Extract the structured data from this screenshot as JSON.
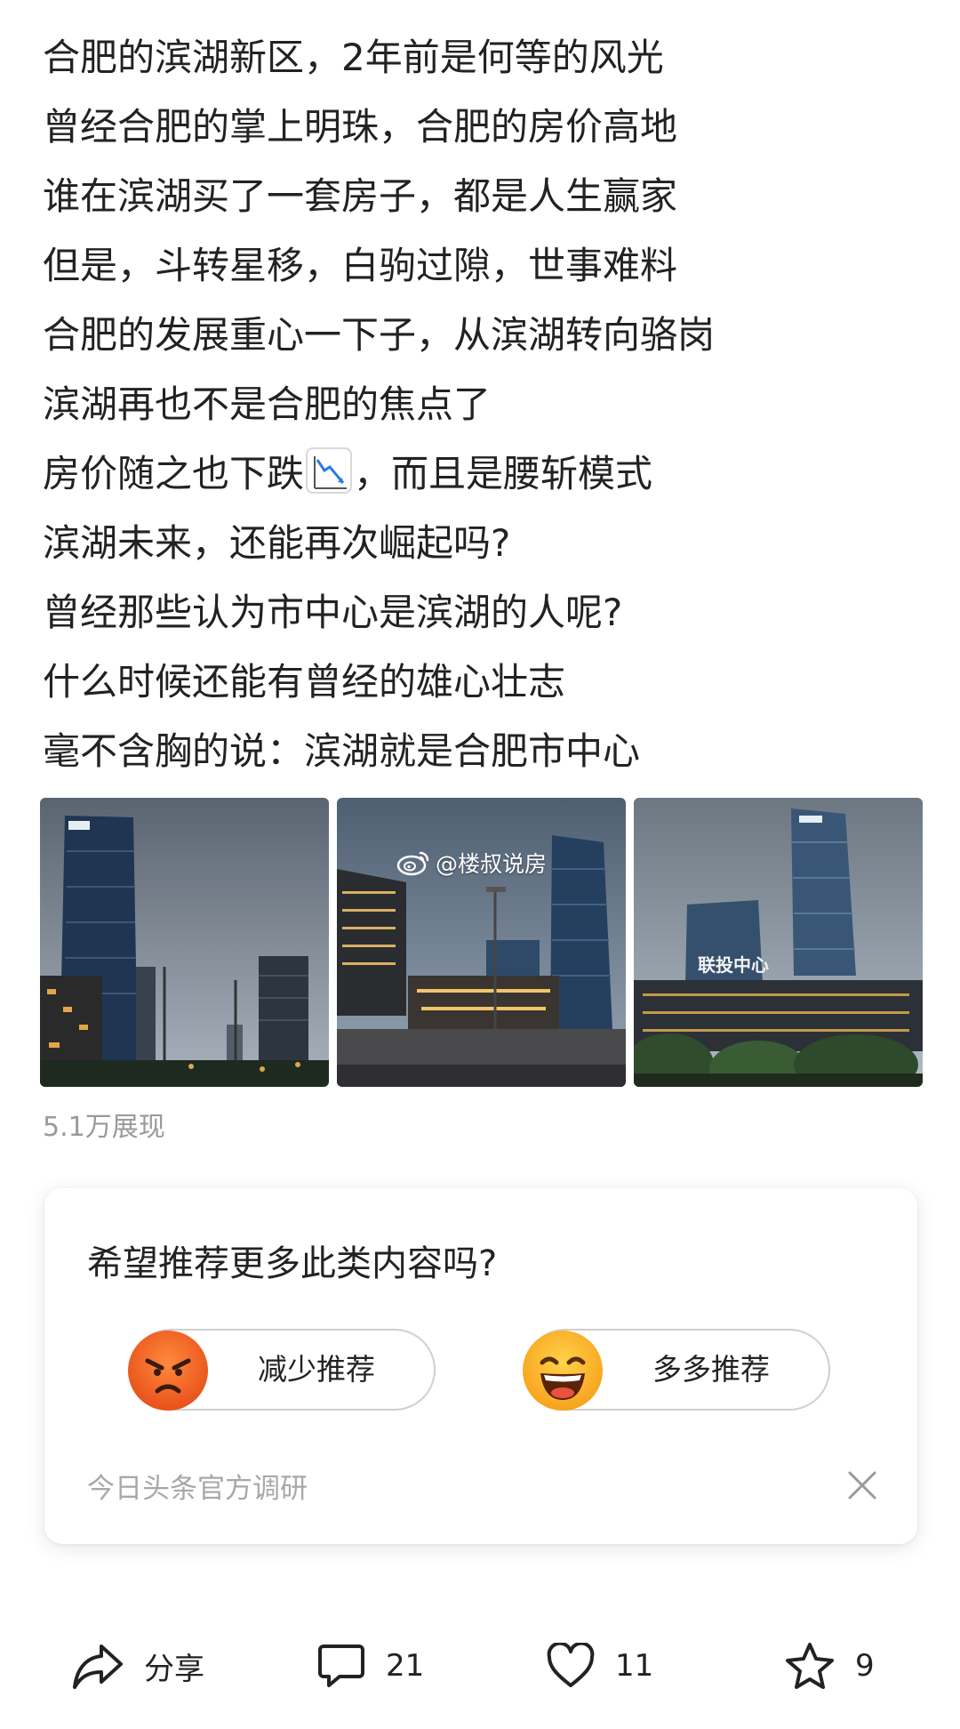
{
  "post": {
    "lines": [
      "合肥的滨湖新区，2年前是何等的风光",
      "曾经合肥的掌上明珠，合肥的房价高地",
      "谁在滨湖买了一套房子，都是人生赢家",
      "但是，斗转星移，白驹过隙，世事难料",
      "合肥的发展重心一下子，从滨湖转向骆岗",
      "滨湖再也不是合肥的焦点了",
      "房价随之也下跌",
      "，而且是腰斩模式",
      "滨湖未来，还能再次崛起吗?",
      "曾经那些认为市中心是滨湖的人呢?",
      "什么时候还能有曾经的雄心壮志",
      "毫不含胸的说：滨湖就是合肥市中心"
    ],
    "emoji": "chart-decreasing-icon",
    "photos": [
      {
        "sign_left": ""
      },
      {
        "sign_mid": ""
      },
      {
        "sign": "联投中心"
      }
    ],
    "watermark": "@楼叔说房",
    "views": "5.1万展现"
  },
  "survey": {
    "question": "希望推荐更多此类内容吗?",
    "less_label": "减少推荐",
    "more_label": "多多推荐",
    "source": "今日头条官方调研",
    "less_color": "#f26a22",
    "more_color": "#ffb21e"
  },
  "actions": {
    "share_label": "分享",
    "comments": "21",
    "likes": "11",
    "favorites": "9"
  }
}
